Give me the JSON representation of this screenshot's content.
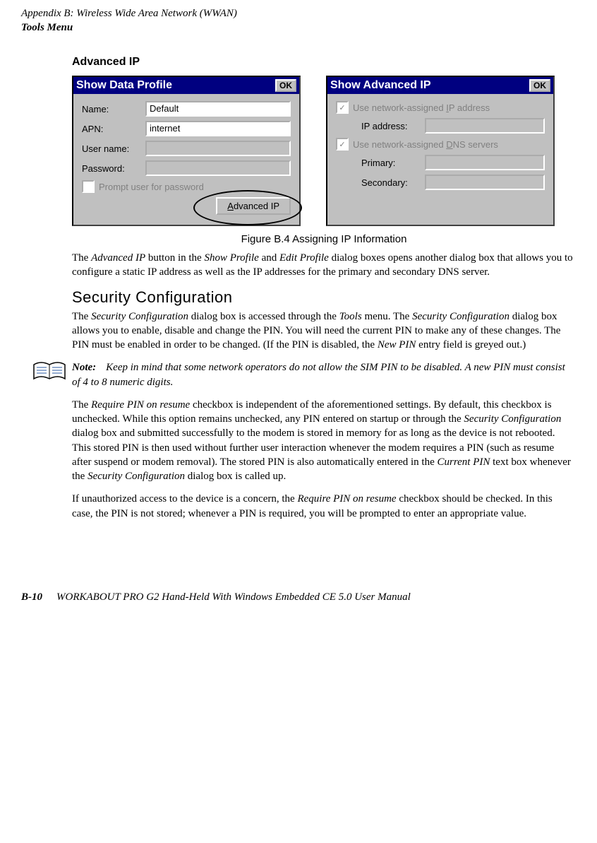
{
  "header": {
    "appendix_line": "Appendix  B:  Wireless Wide Area Network (WWAN)",
    "section_line": "Tools Menu"
  },
  "subheading": "Advanced  IP",
  "dialog1": {
    "title": "Show Data Profile",
    "ok": "OK",
    "name_label": "Name:",
    "name_value": "Default",
    "apn_label": "APN:",
    "apn_value": "internet",
    "user_label": "User name:",
    "user_value": "",
    "pass_label": "Password:",
    "pass_value": "",
    "prompt_label": "Prompt user for password",
    "button": "Advanced IP"
  },
  "dialog2": {
    "title": "Show Advanced IP",
    "ok": "OK",
    "use_ip_label": "Use network-assigned IP address",
    "ip_label": "IP address:",
    "use_dns_label": "Use network-assigned DNS servers",
    "primary_label": "Primary:",
    "secondary_label": "Secondary:"
  },
  "figure_caption": "Figure  B.4   Assigning  IP  Information",
  "para1_a": "The ",
  "para1_b": "Advanced IP",
  "para1_c": " button in the ",
  "para1_d": "Show Profile",
  "para1_e": " and ",
  "para1_f": "Edit Profile",
  "para1_g": " dialog boxes opens another dialog box that allows you to configure a static IP address as well as the IP addresses for the primary and secondary DNS server.",
  "h2": "Security  Configuration",
  "para2_a": "The ",
  "para2_b": "Security Configuration",
  "para2_c": " dialog box is accessed through the ",
  "para2_d": "Tools",
  "para2_e": " menu. The ",
  "para2_f": "Security Configuration",
  "para2_g": " dialog box allows you to enable, disable and change the PIN. You will need the current PIN to make any of these changes. The PIN must be enabled in order to be changed. (If the PIN is disabled, the ",
  "para2_h": "New PIN",
  "para2_i": " entry field is greyed out.)",
  "note_label": "Note:",
  "note_text": "Keep in mind that some network operators do not allow the SIM PIN to be disabled. A new PIN must consist of 4 to 8 numeric digits.",
  "para3_a": "The ",
  "para3_b": "Require PIN  on resume",
  "para3_c": " checkbox is independent of the aforementioned settings. By default, this checkbox is unchecked. While this option remains unchecked, any PIN entered on startup or through the ",
  "para3_d": "Security Configuration",
  "para3_e": " dialog box and submitted successfully to the modem is stored in memory for as long as the device is not rebooted. This stored PIN is then used without further user interaction whenever the modem requires a PIN (such as resume after suspend or modem removal). The stored PIN is also automatically entered in the ",
  "para3_f": "Current PIN",
  "para3_g": " text box whenever the ",
  "para3_h": "Security Configuration",
  "para3_i": " dialog box is called up.",
  "para4_a": "If unauthorized access to the device is a concern, the ",
  "para4_b": "Require PIN on resume",
  "para4_c": " checkbox should be checked. In this case, the PIN is not stored; whenever a PIN is required, you will be prompted to enter an appropriate value.",
  "footer": {
    "page": "B-10",
    "title": "WORKABOUT PRO G2 Hand-Held With Windows Embedded CE 5.0 User Manual"
  }
}
